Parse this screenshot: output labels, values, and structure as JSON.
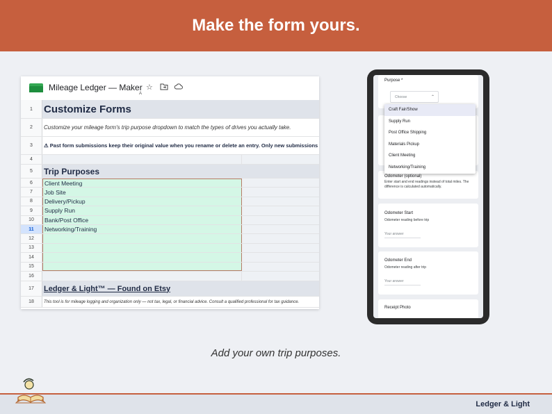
{
  "banner": {
    "title": "Make the form yours."
  },
  "sheet": {
    "doc_title": "Mileage Ledger — Maker",
    "icons": {
      "star": "star-icon",
      "move": "folder-move-icon",
      "cloud": "cloud-icon"
    },
    "column_letter": "A",
    "rows": [
      {
        "num": "1",
        "text": "Customize Forms"
      },
      {
        "num": "2",
        "text": "Customize your mileage form's trip purpose dropdown to match the types of drives you actually take."
      },
      {
        "num": "3",
        "text": "⚠ Past form submissions keep their original value when you rename or delete an entry. Only new submissions use updated values."
      },
      {
        "num": "4",
        "text": ""
      },
      {
        "num": "5",
        "text": "Trip Purposes"
      },
      {
        "num": "6",
        "text": "Client Meeting"
      },
      {
        "num": "7",
        "text": "Job Site"
      },
      {
        "num": "8",
        "text": "Delivery/Pickup"
      },
      {
        "num": "9",
        "text": "Supply Run"
      },
      {
        "num": "10",
        "text": "Bank/Post Office"
      },
      {
        "num": "11",
        "text": "Networking/Training"
      },
      {
        "num": "12",
        "text": ""
      },
      {
        "num": "13",
        "text": ""
      },
      {
        "num": "14",
        "text": ""
      },
      {
        "num": "15",
        "text": ""
      },
      {
        "num": "16",
        "text": ""
      },
      {
        "num": "17",
        "text": "Ledger & Light™  —  Found on Etsy"
      },
      {
        "num": "18",
        "text": "This tool is for mileage logging and organization only — not tax, legal, or financial advice. Consult a qualified professional for tax guidance."
      }
    ],
    "selected_row": "11"
  },
  "form": {
    "purpose_label": "Purpose *",
    "choose_placeholder": "Choose",
    "options": [
      "Craft Fair/Show",
      "Supply Run",
      "Post Office Shipping",
      "Materials Pickup",
      "Client Meeting",
      "Networking/Training"
    ],
    "odometer_optional_title": "Odometer (optional)",
    "odometer_optional_help": "Enter start and end readings instead of total miles. The difference is calculated automatically.",
    "odometer_start_title": "Odometer Start",
    "odometer_start_help": "Odometer reading before trip",
    "odometer_end_title": "Odometer End",
    "odometer_end_help": "Odometer reading after trip",
    "answer_placeholder": "Your answer",
    "receipt_title": "Receipt Photo"
  },
  "caption": "Add your own trip purposes.",
  "footer": {
    "brand": "Ledger & Light"
  },
  "colors": {
    "accent": "#c65f3e",
    "navy": "#1f2a44",
    "green_fill": "#d4f7e6"
  }
}
